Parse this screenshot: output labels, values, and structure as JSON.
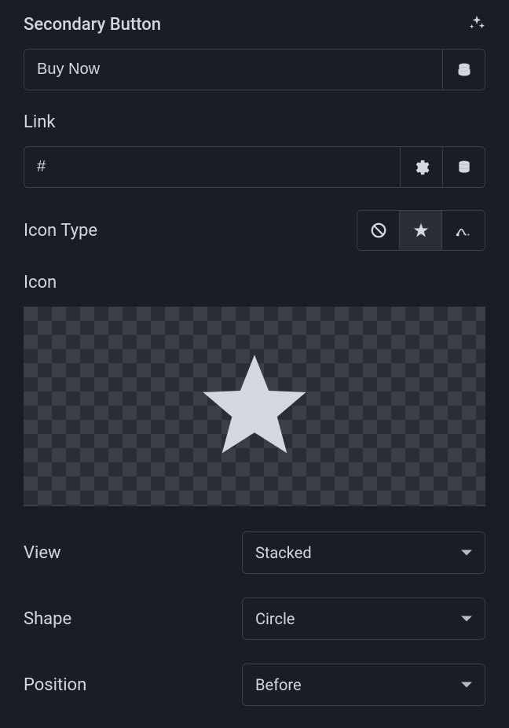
{
  "section": {
    "title": "Secondary Button"
  },
  "fields": {
    "buttonText": {
      "value": "Buy Now"
    },
    "link": {
      "label": "Link",
      "value": "#"
    },
    "iconType": {
      "label": "Icon Type",
      "selected": "star"
    },
    "icon": {
      "label": "Icon"
    },
    "view": {
      "label": "View",
      "value": "Stacked"
    },
    "shape": {
      "label": "Shape",
      "value": "Circle"
    },
    "position": {
      "label": "Position",
      "value": "Before"
    }
  }
}
